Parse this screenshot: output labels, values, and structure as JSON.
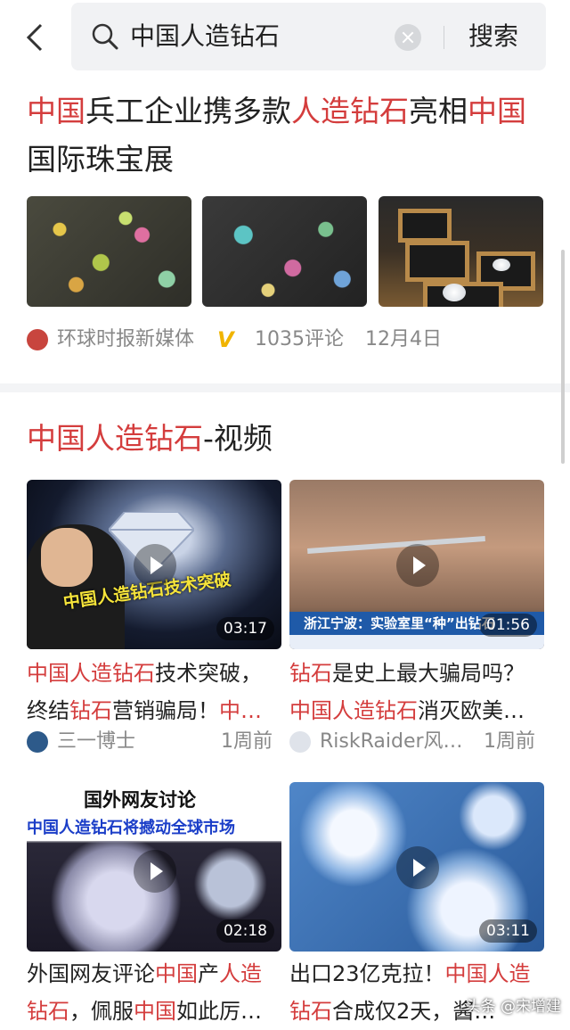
{
  "search": {
    "query": "中国人造钻石",
    "submit_label": "搜索"
  },
  "article1": {
    "title_parts": [
      "中国",
      "兵工企业携多款",
      "人造钻石",
      "亮相",
      "中国",
      "国际珠宝展"
    ],
    "source": "环球时报新媒体",
    "verified_badge": "V",
    "comments": "1035评论",
    "date": "12月4日"
  },
  "video_section": {
    "title_highlight": "中国人造钻石",
    "title_rest": "-视频"
  },
  "videos": [
    {
      "duration": "03:17",
      "overlay_text": "中国人造钻石技术突破",
      "title_parts": [
        "中国人造钻石",
        "技术突破，终结",
        "钻石",
        "营销骗局！",
        "中…"
      ],
      "author": "三一博士",
      "time": "1周前"
    },
    {
      "duration": "01:56",
      "overlay_text": "浙江宁波：实验室里“种”出钻石",
      "title_parts": [
        "钻石",
        "是史上最大骗局吗？",
        "中国人造钻石",
        "消灭欧美…"
      ],
      "author": "RiskRaider风…",
      "time": "1周前"
    },
    {
      "duration": "02:18",
      "overlay_line1": "国外网友讨论",
      "overlay_line2": "中国人造钻石将撼动全球市场",
      "title_parts": [
        "外国网友评论",
        "中国",
        "产",
        "人造",
        "钻石",
        "，佩服",
        "中国",
        "如此厉…"
      ]
    },
    {
      "duration": "03:11",
      "title_parts": [
        "出口23亿克拉！",
        "中国人",
        "造钻石",
        "合成仅2天，",
        "酱…"
      ]
    }
  ],
  "watermark": "头条 @宋增建",
  "colors": {
    "highlight": "#d43d3d",
    "meta": "#888888",
    "badge": "#f0b400"
  }
}
